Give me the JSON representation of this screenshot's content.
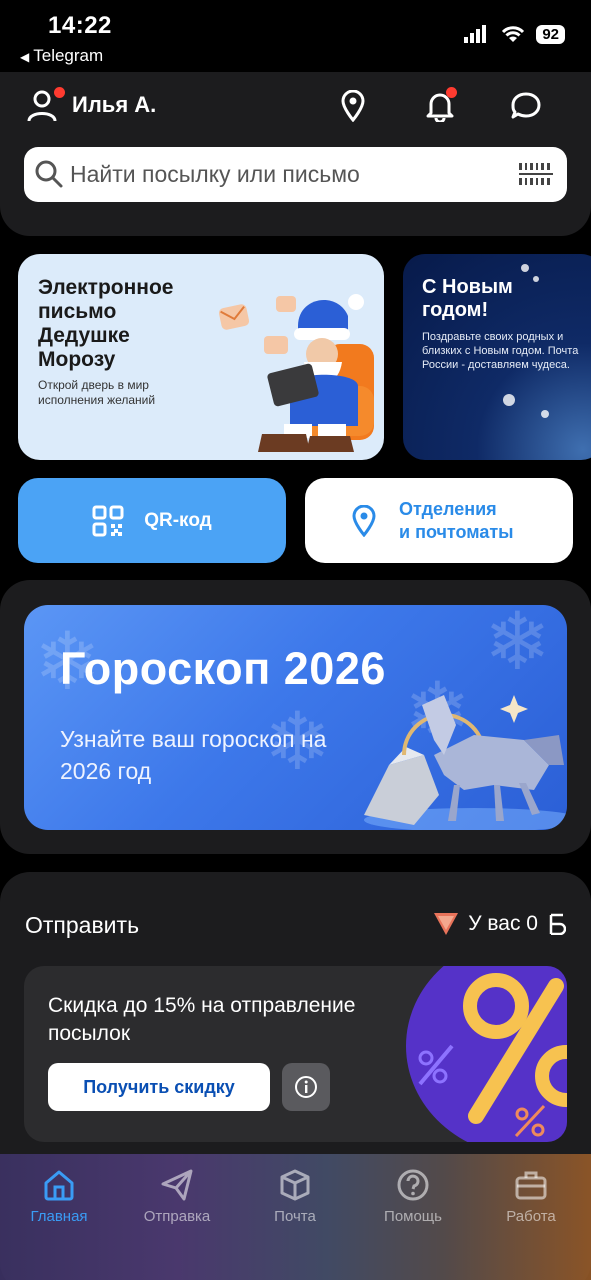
{
  "status_bar": {
    "time": "14:22",
    "back_app": "Telegram",
    "battery": "92"
  },
  "header": {
    "user_name": "Илья А."
  },
  "search": {
    "placeholder": "Найти посылку или письмо"
  },
  "promo_cards": [
    {
      "title": "Электронное письмо Дедушке Морозу",
      "subtitle": "Открой дверь в мир исполнения желаний"
    },
    {
      "title": "С Новым годом!",
      "subtitle": "Поздравьте своих родных и близких с Новым годом. Почта России - доставляем чудеса."
    }
  ],
  "quick_actions": {
    "qr_label": "QR-код",
    "offices_line1": "Отделения",
    "offices_line2": "и почтоматы"
  },
  "horoscope": {
    "title": "Гороскоп 2026",
    "subtitle": "Узнайте ваш гороскоп на 2026 год"
  },
  "send": {
    "title": "Отправить",
    "points_label": "У вас 0",
    "discount_text": "Скидка до 15% на отправление посылок",
    "discount_button": "Получить скидку"
  },
  "tabbar": [
    {
      "label": "Главная",
      "active": true
    },
    {
      "label": "Отправка"
    },
    {
      "label": "Почта"
    },
    {
      "label": "Помощь"
    },
    {
      "label": "Работа"
    }
  ],
  "colors": {
    "accent": "#3a9cf5",
    "brand_blue": "#0a4fb3",
    "notification": "#ff3b30"
  }
}
